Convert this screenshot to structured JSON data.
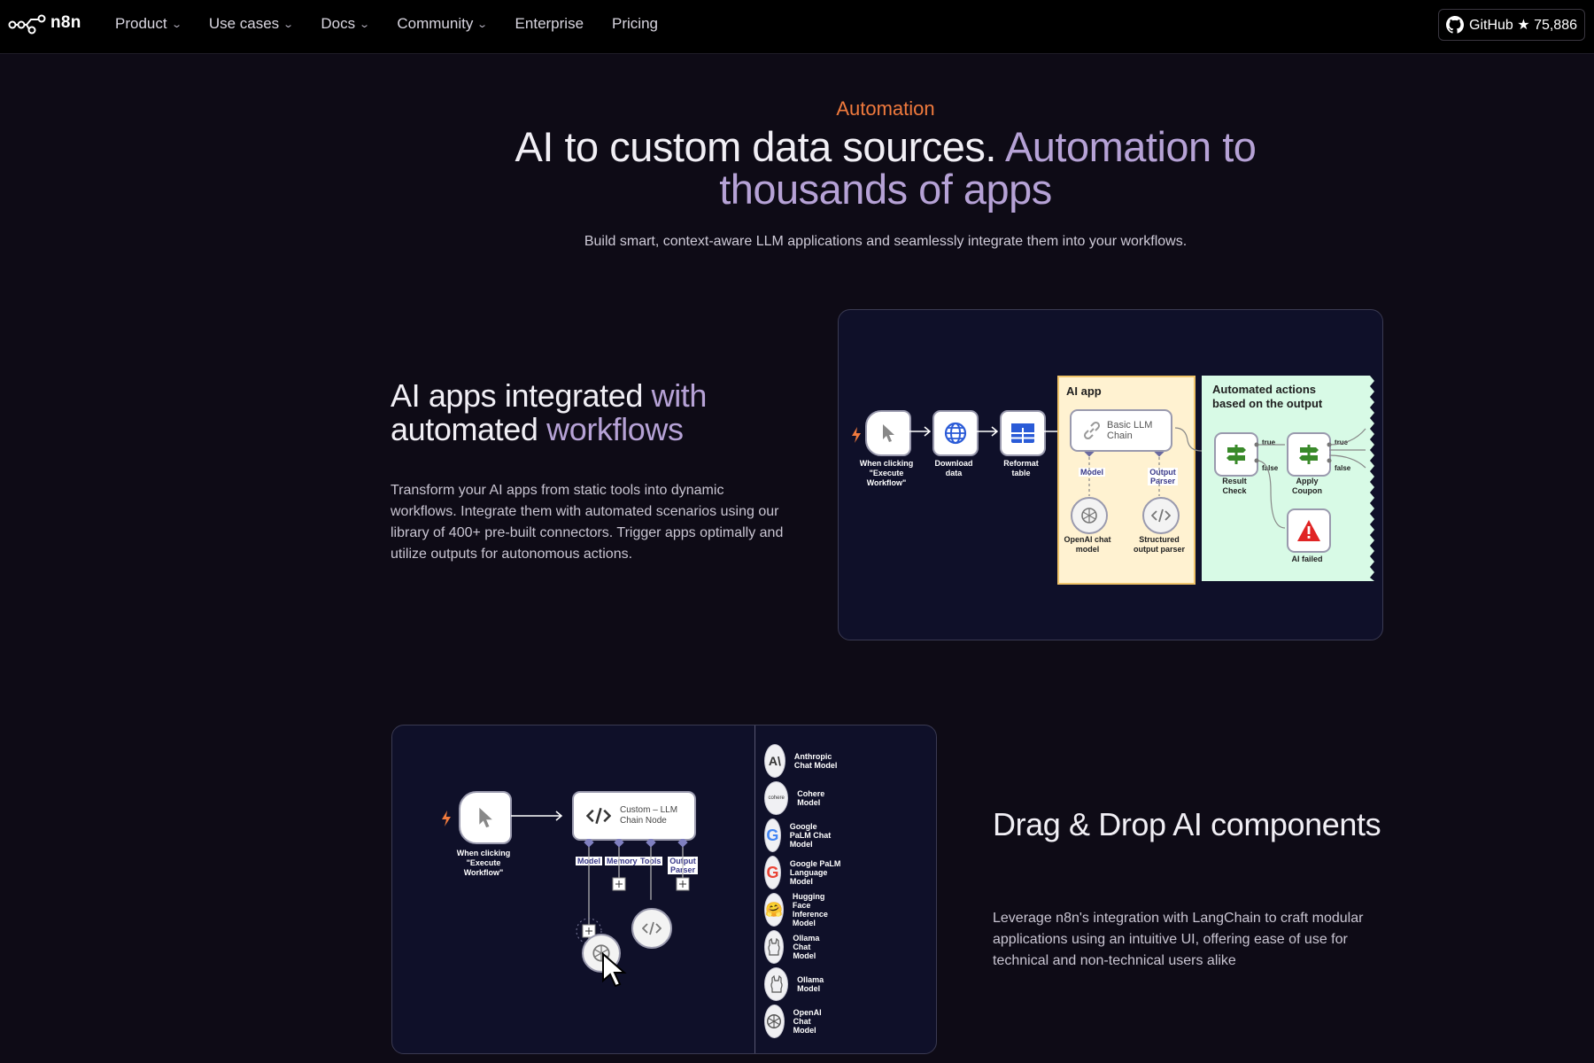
{
  "nav": {
    "logo_text": "n8n",
    "items": [
      {
        "label": "Product",
        "dropdown": true
      },
      {
        "label": "Use cases",
        "dropdown": true
      },
      {
        "label": "Docs",
        "dropdown": true
      },
      {
        "label": "Community",
        "dropdown": true
      },
      {
        "label": "Enterprise",
        "dropdown": false
      },
      {
        "label": "Pricing",
        "dropdown": false
      }
    ],
    "github_label": "GitHub ★ 75,886"
  },
  "hero": {
    "eyebrow": "Automation",
    "title_white": "AI to custom data sources. ",
    "title_purple": "Automation to thousands of apps",
    "subtitle": "Build smart, context-aware LLM applications and seamlessly integrate them into your workflows."
  },
  "section1": {
    "title_white": "AI apps integrated ",
    "title_purple_1": "with",
    "title_white_2": "automated ",
    "title_purple_2": "workflows",
    "body": "Transform your AI apps from static tools into dynamic workflows. Integrate them with automated scenarios using our library of 400+ pre-built connectors. Trigger apps optimally and utilize outputs for autonomous actions.",
    "diagram": {
      "trigger_label": "When clicking \"Execute Workflow\"",
      "download_label": "Download data",
      "reformat_label": "Reformat table",
      "ai_zone_title": "AI app",
      "llm_chain_label": "Basic LLM Chain",
      "model_tag": "Model",
      "parser_tag": "Output Parser",
      "openai_label": "OpenAI chat model",
      "parser_label": "Structured output parser",
      "auto_zone_title": "Automated actions based on the output",
      "result_label": "Result Check",
      "coupon_label": "Apply Coupon",
      "failed_label": "AI failed",
      "true_1": "true",
      "false_1": "false",
      "true_2": "true",
      "false_2": "false"
    }
  },
  "section2": {
    "title": "Drag & Drop AI components",
    "body": "Leverage n8n's integration with LangChain to craft modular applications using an intuitive UI, offering ease of use for technical and non-technical users alike",
    "diagram": {
      "trigger_label": "When clicking \"Execute Workflow\"",
      "chain_label": "Custom – LLM Chain Node",
      "tags": [
        "Model",
        "Memory",
        "Tools",
        "Output Parser"
      ]
    },
    "models": [
      {
        "name": "Anthropic Chat Model",
        "icon": "A\\"
      },
      {
        "name": "Cohere Model",
        "icon": "cohere"
      },
      {
        "name": "Google PaLM Chat Model",
        "icon": "G"
      },
      {
        "name": "Google PaLM Language Model",
        "icon": "G"
      },
      {
        "name": "Hugging Face Inference Model",
        "icon": "🤗"
      },
      {
        "name": "Ollama Chat Model",
        "icon": "ollama"
      },
      {
        "name": "Ollama Model",
        "icon": "ollama"
      },
      {
        "name": "OpenAI Chat Model",
        "icon": "openai"
      }
    ]
  },
  "colors": {
    "accent_orange": "#f07a3d",
    "accent_purple": "#b6a2d6",
    "background": "#0e0b16"
  }
}
